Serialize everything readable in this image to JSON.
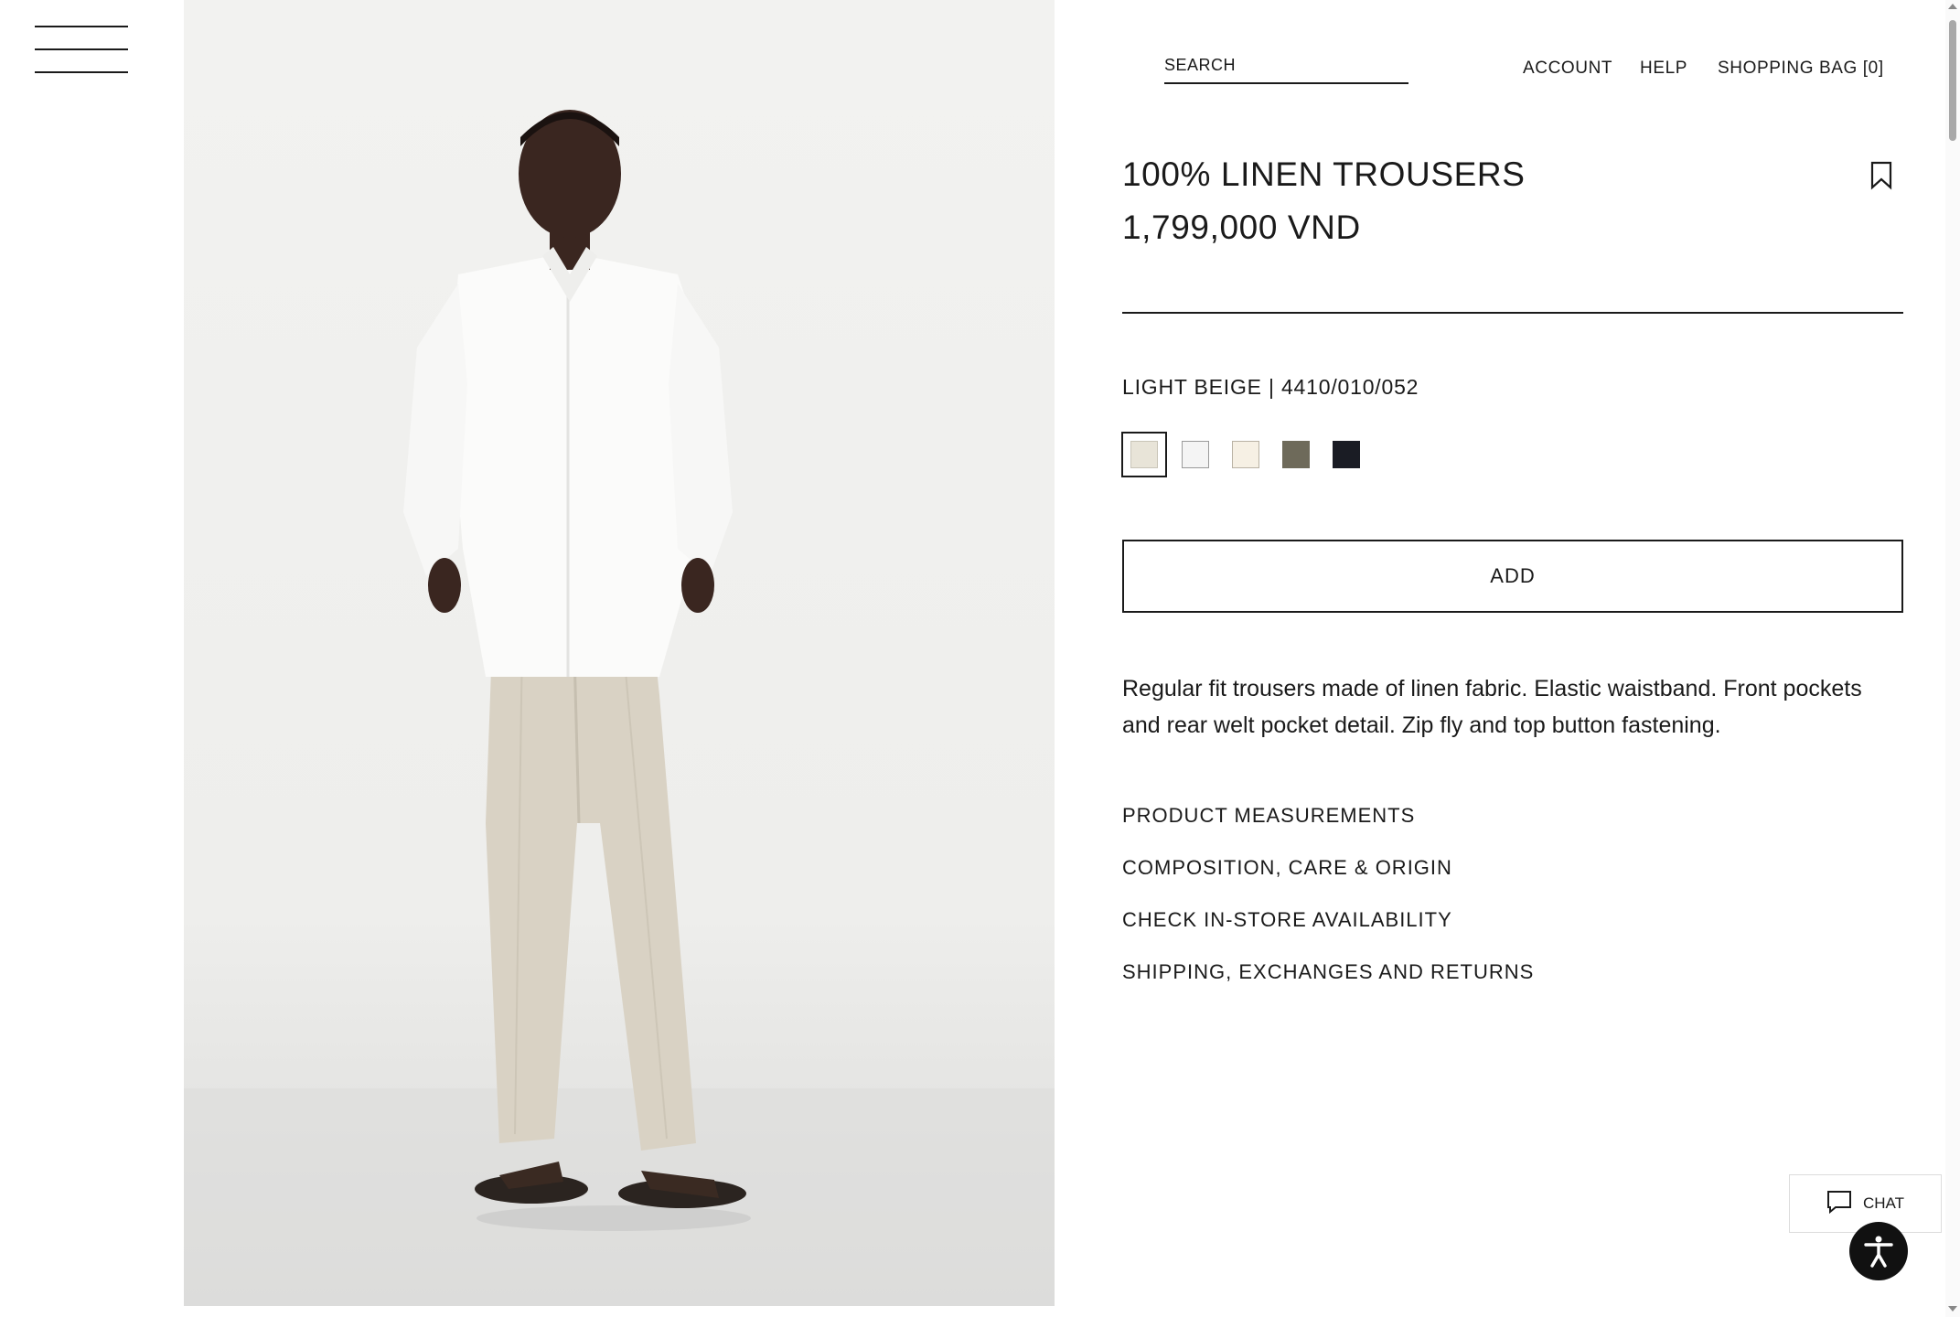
{
  "header": {
    "menu_icon": "hamburger-menu-icon",
    "search_placeholder": "SEARCH",
    "account_label": "ACCOUNT",
    "help_label": "HELP",
    "shopping_bag_label": "SHOPPING BAG [0]"
  },
  "product": {
    "title": "100% LINEN TROUSERS",
    "price": "1,799,000 VND",
    "bookmark_icon": "bookmark-icon",
    "color_label": "LIGHT BEIGE | 4410/010/052",
    "swatches": [
      {
        "name": "light beige",
        "color": "#e8e4d8",
        "selected": true
      },
      {
        "name": "white",
        "color": "#f4f4f4",
        "selected": false
      },
      {
        "name": "ecru",
        "color": "#f6f0e4",
        "selected": false
      },
      {
        "name": "khaki",
        "color": "#6e6a5a",
        "selected": false
      },
      {
        "name": "black",
        "color": "#1a1c24",
        "selected": false
      }
    ],
    "add_label": "ADD",
    "description": "Regular fit trousers made of linen fabric. Elastic waistband. Front pockets and rear welt pocket detail. Zip fly and top button fastening.",
    "info_links": [
      "PRODUCT MEASUREMENTS",
      "COMPOSITION, CARE & ORIGIN",
      "CHECK IN-STORE AVAILABILITY",
      "SHIPPING, EXCHANGES AND RETURNS"
    ]
  },
  "widgets": {
    "chat_label": "CHAT",
    "chat_icon": "chat-bubble-icon",
    "accessibility_icon": "accessibility-icon"
  }
}
